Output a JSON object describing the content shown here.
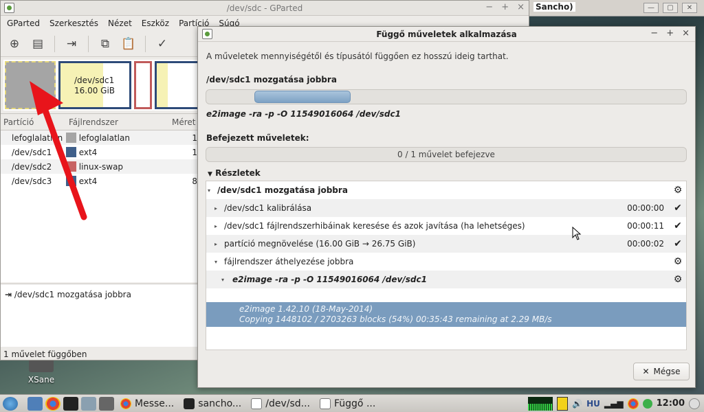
{
  "desktop": {
    "icon_label": "XSane"
  },
  "bg_window": {
    "title": "Sancho)"
  },
  "gparted": {
    "title": "/dev/sdc - GParted",
    "menu": [
      "GParted",
      "Szerkesztés",
      "Nézet",
      "Eszköz",
      "Partíció",
      "Súgó"
    ],
    "diskmap": {
      "sdc1_name": "/dev/sdc1",
      "sdc1_size": "16.00 GiB"
    },
    "table": {
      "headers": [
        "Partíció",
        "Fájlrendszer",
        "Méret"
      ],
      "rows": [
        {
          "part": "lefoglalatlan",
          "fs": "lefoglalatlan",
          "size": "1",
          "color": "#a5a5a5"
        },
        {
          "part": "/dev/sdc1",
          "fs": "ext4",
          "size": "1",
          "color": "#3f5f8a"
        },
        {
          "part": "/dev/sdc2",
          "fs": "linux-swap",
          "size": "",
          "color": "#c86464"
        },
        {
          "part": "/dev/sdc3",
          "fs": "ext4",
          "size": "8",
          "color": "#3f5f8a"
        }
      ]
    },
    "pending_op": "/dev/sdc1 mozgatása jobbra",
    "status": "1 művelet függőben"
  },
  "dialog": {
    "title": "Függő műveletek alkalmazása",
    "info": "A műveletek mennyiségétől és típusától függően ez hosszú ideig tarthat.",
    "current_op": "/dev/sdc1 mozgatása jobbra",
    "current_cmd": "e2image -ra -p -O 11549016064 /dev/sdc1",
    "completed_label": "Befejezett műveletek:",
    "completed_text": "0 / 1 művelet befejezve",
    "completed_fraction": 0,
    "details_label": "Részletek",
    "tree": [
      {
        "label": "/dev/sdc1 mozgatása jobbra",
        "time": "",
        "status": "running"
      },
      {
        "label": "/dev/sdc1 kalibrálása",
        "time": "00:00:00",
        "status": "done"
      },
      {
        "label": "/dev/sdc1 fájlrendszerhibáinak keresése és azok javítása (ha lehetséges)",
        "time": "00:00:11",
        "status": "done"
      },
      {
        "label": "partíció megnövelése (16.00 GiB → 26.75 GiB)",
        "time": "00:00:02",
        "status": "done"
      },
      {
        "label": "fájlrendszer áthelyezése jobbra",
        "time": "",
        "status": "running"
      },
      {
        "label": "e2image -ra -p -O 11549016064 /dev/sdc1",
        "time": "",
        "status": "running"
      }
    ],
    "output_line1": "e2image 1.42.10 (18-May-2014)",
    "output_line2": "Copying 1448102 / 2703263 blocks (54%) 00:35:43 remaining at 2.29 MB/s",
    "cancel_label": "Mégse"
  },
  "taskbar": {
    "tasks": [
      "Messe...",
      "sancho...",
      "/dev/sd...",
      "Függő ..."
    ],
    "lang": "HU",
    "clock": "12:00"
  }
}
